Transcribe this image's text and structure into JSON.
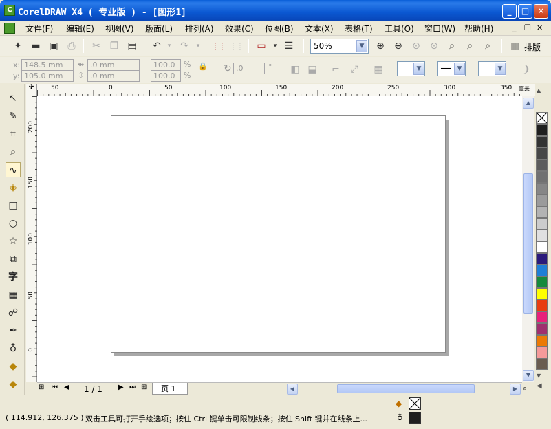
{
  "title": "CorelDRAW X4 ( 专业版 ) - [图形1]",
  "window_buttons": {
    "minimize": "_",
    "maximize": "□",
    "close": "✕"
  },
  "menu": [
    "文件(F)",
    "编辑(E)",
    "视图(V)",
    "版面(L)",
    "排列(A)",
    "效果(C)",
    "位图(B)",
    "文本(X)",
    "表格(T)",
    "工具(O)",
    "窗口(W)",
    "帮助(H)"
  ],
  "doc_controls": {
    "minimize": "_",
    "restore": "❐",
    "close": "✕"
  },
  "standard_toolbar": {
    "zoom_value": "50%",
    "arrange_label": "排版"
  },
  "property_bar": {
    "x_label": "x:",
    "x_value": "148.5 mm",
    "y_label": "y:",
    "y_value": "105.0 mm",
    "w_value": ".0 mm",
    "h_value": ".0 mm",
    "scale_x": "100.0",
    "scale_y": "100.0",
    "percent": "%",
    "angle_value": ".0",
    "degree": "°"
  },
  "ruler": {
    "top_labels": [
      "50",
      "0",
      "50",
      "100",
      "150",
      "200",
      "250",
      "300",
      "350"
    ],
    "unit": "毫米",
    "left_labels": [
      "200",
      "150",
      "100",
      "50",
      "0"
    ]
  },
  "page_nav": {
    "counter": "1 / 1",
    "tab": "页 1"
  },
  "palette_colors": [
    "#1f1f1f",
    "#333333",
    "#474747",
    "#5c5c5c",
    "#717171",
    "#868686",
    "#9b9b9b",
    "#b3b3b3",
    "#cccccc",
    "#e0e0e0",
    "#ffffff",
    "#2b1a7a",
    "#1f7fd6",
    "#178a3c",
    "#ffff00",
    "#e83d10",
    "#e8207a",
    "#a02f6e",
    "#ec7a05",
    "#f59a9a",
    "#6a5c50"
  ],
  "status": {
    "coords": "( 114.912, 126.375 )",
    "hint": "双击工具可打开手绘选项；按住 Ctrl 键单击可限制线条；按住 Shift 键并在线条上..."
  }
}
